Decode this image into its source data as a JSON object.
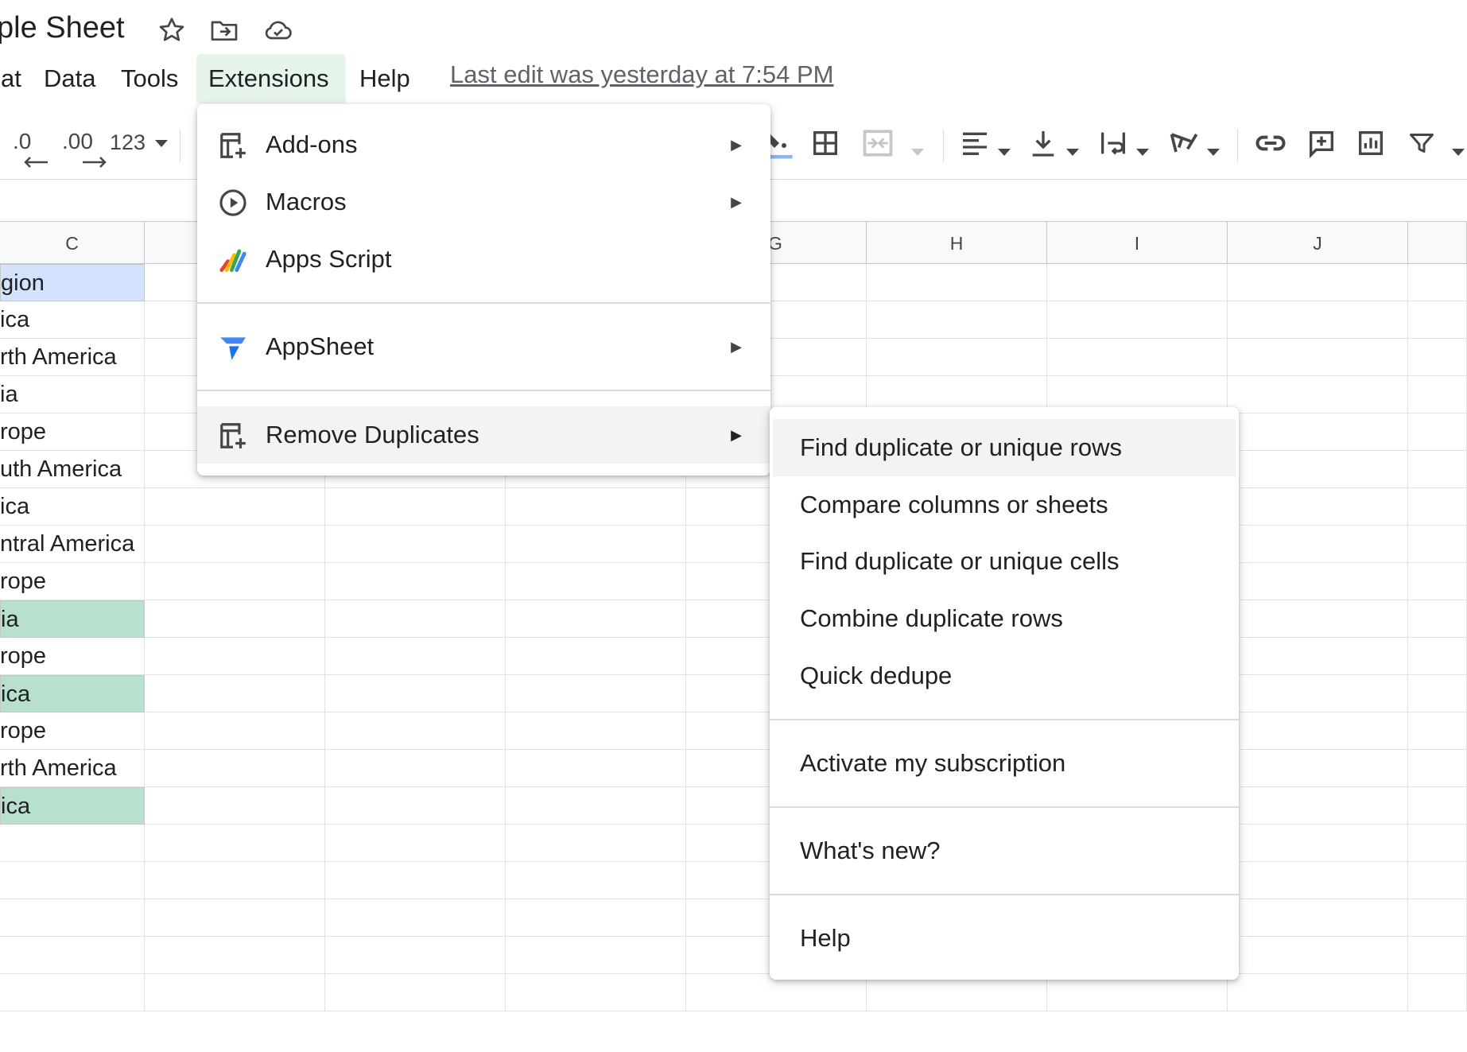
{
  "document": {
    "title": "ple Sheet"
  },
  "menubar": {
    "items": [
      {
        "label": "at"
      },
      {
        "label": "Data"
      },
      {
        "label": "Tools"
      },
      {
        "label": "Extensions"
      },
      {
        "label": "Help"
      }
    ],
    "last_edit": "Last edit was yesterday at 7:54 PM"
  },
  "toolbar": {
    "decrease_decimal": ".0",
    "increase_decimal": ".00",
    "number_format": "123"
  },
  "grid": {
    "columns": [
      "C",
      "",
      "",
      "",
      "G",
      "H",
      "I",
      "J",
      ""
    ],
    "column_c_cells": [
      "gion",
      "ica",
      "rth America",
      "ia",
      "rope",
      "uth America",
      "ica",
      "ntral America",
      "rope",
      "ia",
      "rope",
      "ica",
      "rope",
      "rth America",
      "ica",
      "",
      "",
      "",
      "",
      ""
    ]
  },
  "extensions_menu": {
    "items": [
      {
        "label": "Add-ons",
        "icon": "add-ons-icon"
      },
      {
        "label": "Macros",
        "icon": "macros-play-icon"
      },
      {
        "label": "Apps Script",
        "icon": "apps-script-icon"
      },
      {
        "label": "AppSheet",
        "icon": "appsheet-icon"
      },
      {
        "label": "Remove Duplicates",
        "icon": "remove-duplicates-icon"
      }
    ]
  },
  "remove_duplicates_submenu": {
    "items": [
      "Find duplicate or unique rows",
      "Compare columns or sheets",
      "Find duplicate or unique cells",
      "Combine duplicate rows",
      "Quick dedupe",
      "Activate my subscription",
      "What's new?",
      "Help"
    ]
  },
  "colors": {
    "selected_cell": "#d3e3fd",
    "duplicate_highlight": "#b7e1cd",
    "active_menu": "#e6f4ea",
    "hover_row": "#f1f3f4"
  }
}
